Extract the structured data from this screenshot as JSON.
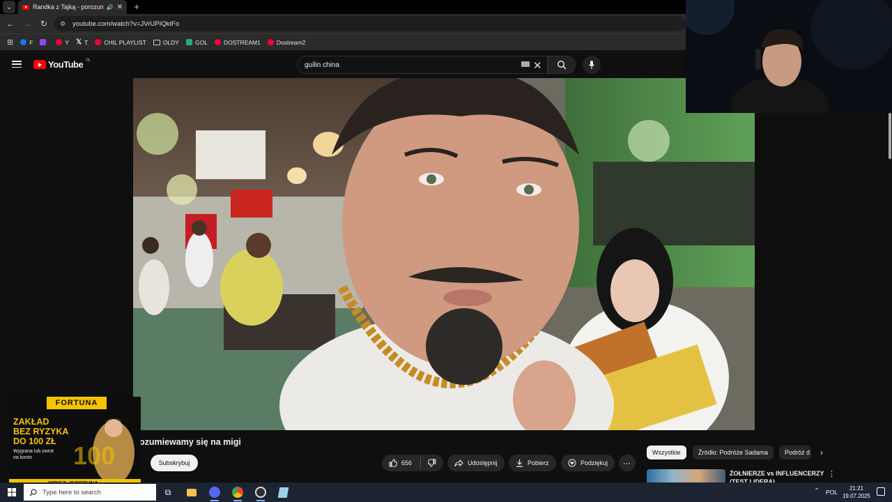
{
  "browser": {
    "tab_title": "Randka z Tajką - porozumiewamy się na migi",
    "url": "youtube.com/watch?v=JVrUPIQktFo",
    "bookmarks": [
      {
        "label": "F",
        "icon": "facebook-icon",
        "color": "#1877f2"
      },
      {
        "label": "",
        "icon": "twitch-icon",
        "color": "#9146ff"
      },
      {
        "label": "Y",
        "icon": "youtube-icon",
        "color": "#ff0033"
      },
      {
        "label": "T",
        "icon": "x-icon",
        "color": "#ffffff"
      },
      {
        "label": "CHIL PLAYLIST",
        "icon": "youtube-icon",
        "color": "#ff0033"
      },
      {
        "label": "OLDY",
        "icon": "folder-icon",
        "color": "#cccccc"
      },
      {
        "label": "GOL",
        "icon": "gol-icon",
        "color": "#2aa876"
      },
      {
        "label": "DOSTREAM1",
        "icon": "youtube-icon",
        "color": "#ff0033"
      },
      {
        "label": "Dostream2",
        "icon": "youtube-icon",
        "color": "#ff0033"
      }
    ]
  },
  "youtube": {
    "logo_text": "YouTube",
    "region": "PL",
    "search_query": "guilin china",
    "video_title": "ozumiewamy się na migi",
    "subscribe_label": "Subskrybuj",
    "like_count": "656",
    "share_label": "Udostępnij",
    "download_label": "Pobierz",
    "thanks_label": "Podziękuj",
    "chips": [
      "Wszystkie",
      "Źródło: Podróże Sadama",
      "Podróż d"
    ],
    "recommended_title": "ŻOŁNIERZE vs INFLUENCERZY (TEST LIDERA)"
  },
  "ad": {
    "brand": "FORTUNA",
    "headline_1": "ZAKŁAD",
    "headline_2": "BEZ RYZYKA",
    "headline_3": "DO 100 ZŁ",
    "subtext_1": "Wygrana lub zwrot",
    "subtext_2": "na konto",
    "big_number": "100",
    "code": "WPISZ: !FORTUNA"
  },
  "taskbar": {
    "search_placeholder": "Type here to search",
    "language": "POL",
    "time": "21:21",
    "date": "19.07.2025"
  },
  "colors": {
    "yt_red": "#ff0000",
    "fortuna_yellow": "#f5c400",
    "taskbar_bg": "#1c2331"
  }
}
